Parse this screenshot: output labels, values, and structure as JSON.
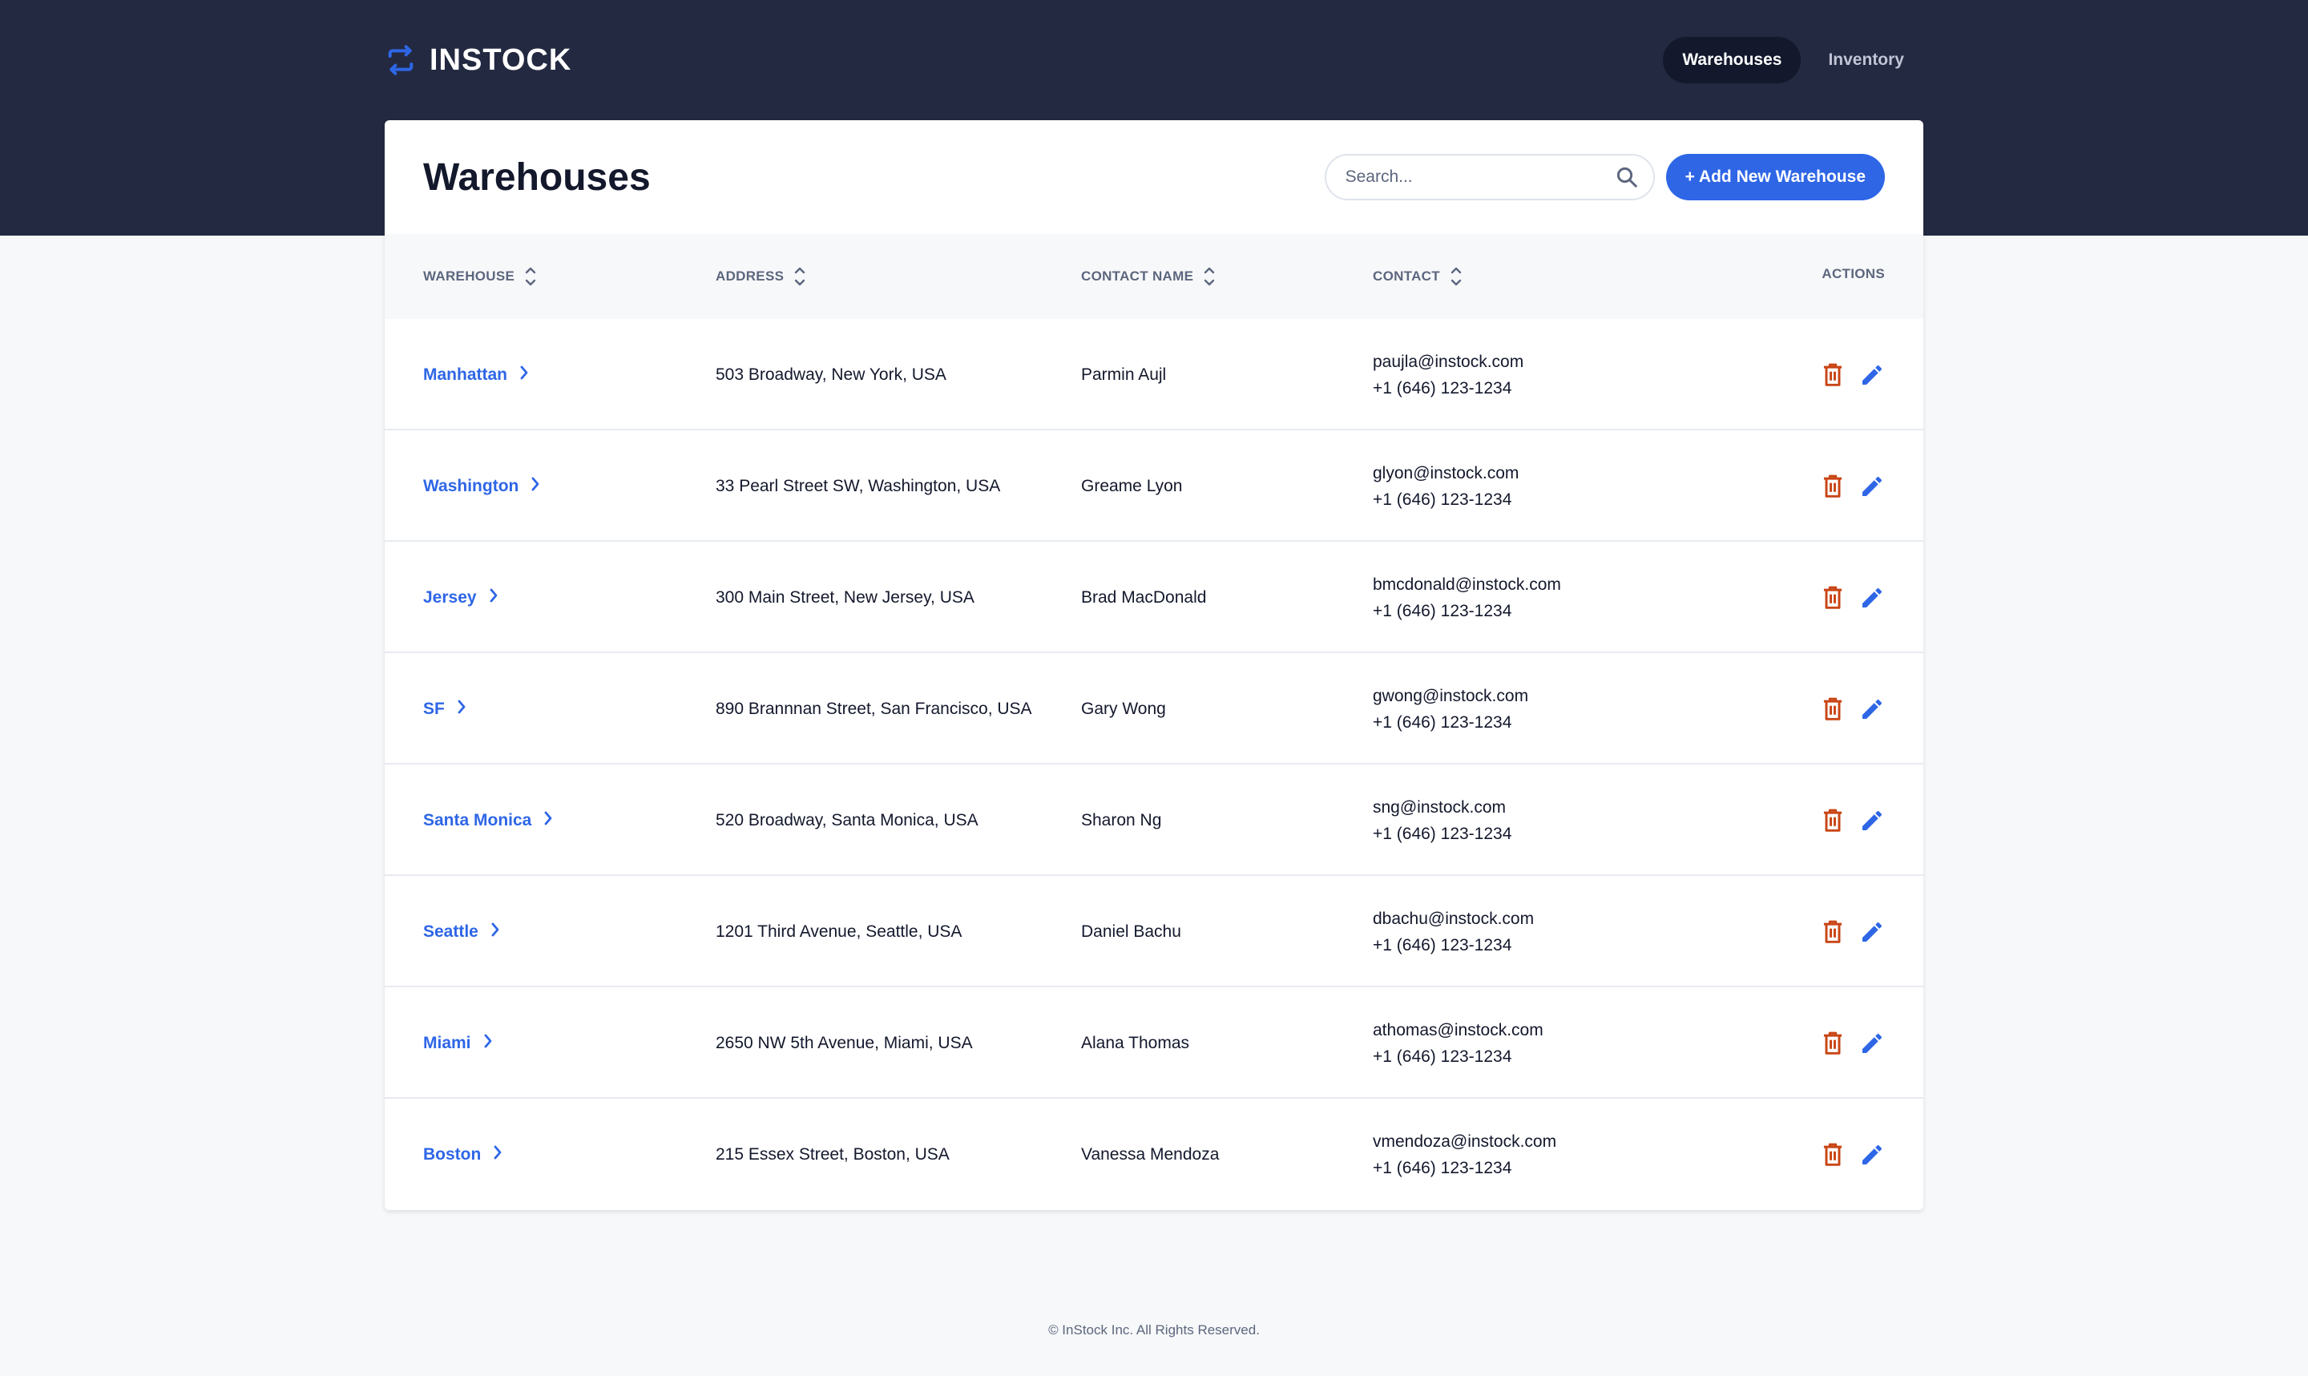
{
  "header": {
    "logo_text": "INSTOCK",
    "nav": [
      {
        "label": "Warehouses",
        "active": true
      },
      {
        "label": "Inventory",
        "active": false
      }
    ]
  },
  "page": {
    "title": "Warehouses",
    "search_placeholder": "Search...",
    "add_button_label": "+ Add New Warehouse"
  },
  "table": {
    "columns": {
      "warehouse": "WAREHOUSE",
      "address": "ADDRESS",
      "contact_name": "CONTACT NAME",
      "contact": "CONTACT",
      "actions": "ACTIONS"
    },
    "rows": [
      {
        "warehouse": "Manhattan",
        "address": "503 Broadway, New York, USA",
        "contact_name": "Parmin Aujl",
        "email": "paujla@instock.com",
        "phone": "+1 (646) 123-1234"
      },
      {
        "warehouse": "Washington",
        "address": "33 Pearl Street SW, Washington, USA",
        "contact_name": "Greame Lyon",
        "email": "glyon@instock.com",
        "phone": "+1 (646) 123-1234"
      },
      {
        "warehouse": "Jersey",
        "address": "300 Main Street, New Jersey, USA",
        "contact_name": "Brad MacDonald",
        "email": "bmcdonald@instock.com",
        "phone": "+1 (646) 123-1234"
      },
      {
        "warehouse": "SF",
        "address": "890 Brannnan Street, San Francisco, USA",
        "contact_name": "Gary Wong",
        "email": "gwong@instock.com",
        "phone": "+1 (646) 123-1234"
      },
      {
        "warehouse": "Santa Monica",
        "address": "520 Broadway, Santa Monica, USA",
        "contact_name": "Sharon Ng",
        "email": "sng@instock.com",
        "phone": "+1 (646) 123-1234"
      },
      {
        "warehouse": "Seattle",
        "address": "1201 Third Avenue, Seattle, USA",
        "contact_name": "Daniel Bachu",
        "email": "dbachu@instock.com",
        "phone": "+1 (646) 123-1234"
      },
      {
        "warehouse": "Miami",
        "address": "2650 NW 5th Avenue, Miami, USA",
        "contact_name": "Alana Thomas",
        "email": "athomas@instock.com",
        "phone": "+1 (646) 123-1234"
      },
      {
        "warehouse": "Boston",
        "address": "215 Essex Street, Boston, USA",
        "contact_name": "Vanessa Mendoza",
        "email": "vmendoza@instock.com",
        "phone": "+1 (646) 123-1234"
      }
    ]
  },
  "footer": {
    "text": "© InStock Inc. All Rights Reserved."
  },
  "colors": {
    "header_bg": "#232940",
    "accent": "#2e66e6",
    "danger": "#c94515",
    "text_primary": "#13182c",
    "text_secondary": "#5c667e"
  },
  "icons": {
    "logo": "swap-arrows-icon",
    "search": "search-icon",
    "sort": "sort-icon",
    "row_link": "chevron-right-icon",
    "delete": "trash-icon",
    "edit": "pencil-icon"
  }
}
